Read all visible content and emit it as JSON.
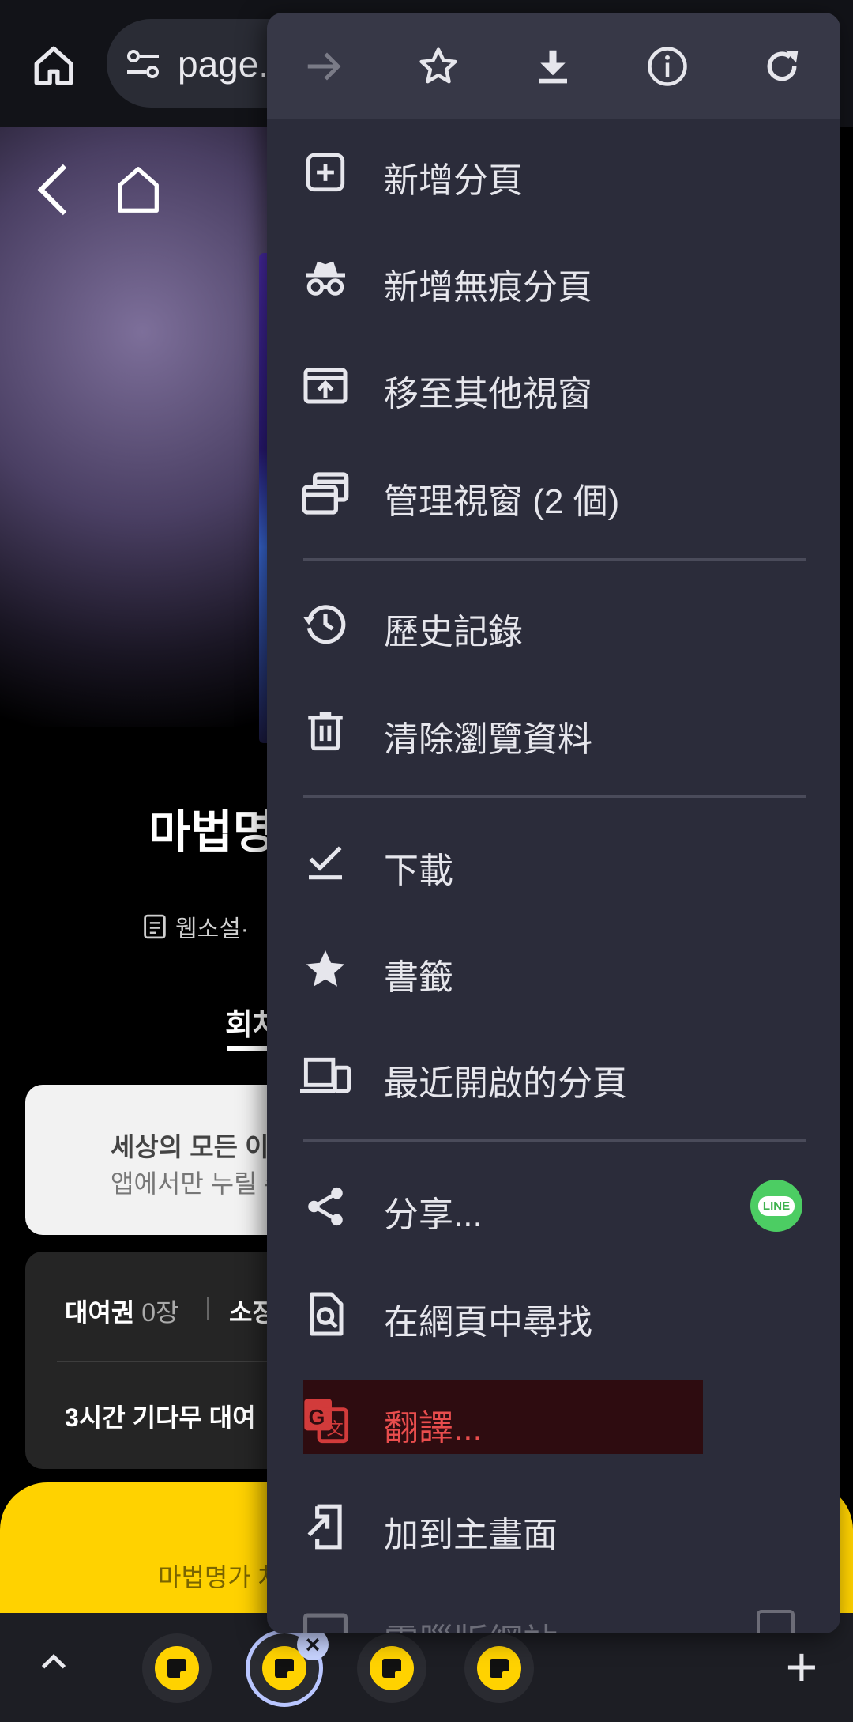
{
  "browser": {
    "url_text": "page."
  },
  "page": {
    "title": "마법명",
    "meta": "웹소설·",
    "tab_label": "회차",
    "notice": {
      "title": "세상의 모든 이",
      "subtitle": "앱에서만 누릴 수"
    },
    "info": {
      "rent_label": "대여권",
      "rent_count": "0장",
      "own_label": "소장",
      "wait_label": "3시간 기다무 대여"
    },
    "yellow_text": "마법명가 차"
  },
  "menu": {
    "top_icons": [
      "forward-icon",
      "bookmark-star-icon",
      "download-icon",
      "info-icon",
      "refresh-icon"
    ],
    "items": [
      {
        "label": "新增分頁",
        "icon": "new-tab-icon"
      },
      {
        "label": "新增無痕分頁",
        "icon": "incognito-icon"
      },
      {
        "label": "移至其他視窗",
        "icon": "move-window-icon"
      },
      {
        "label": "管理視窗 (2 個)",
        "icon": "manage-windows-icon"
      },
      {
        "label": "歷史記錄",
        "icon": "history-icon"
      },
      {
        "label": "清除瀏覽資料",
        "icon": "trash-icon"
      },
      {
        "label": "下載",
        "icon": "downloads-icon"
      },
      {
        "label": "書籤",
        "icon": "star-icon"
      },
      {
        "label": "最近開啟的分頁",
        "icon": "devices-icon"
      },
      {
        "label": "分享...",
        "icon": "share-icon"
      },
      {
        "label": "在網頁中尋找",
        "icon": "find-in-page-icon"
      },
      {
        "label": "翻譯...",
        "icon": "translate-icon"
      },
      {
        "label": "加到主畫面",
        "icon": "add-to-home-icon"
      },
      {
        "label": "電腦版網站",
        "icon": "desktop-site-icon"
      }
    ],
    "share_badge": "LINE",
    "highlight_color": "#2e0c10",
    "accent_red": "#e94d4d"
  },
  "bottom": {
    "plus": "+",
    "close": "×"
  }
}
